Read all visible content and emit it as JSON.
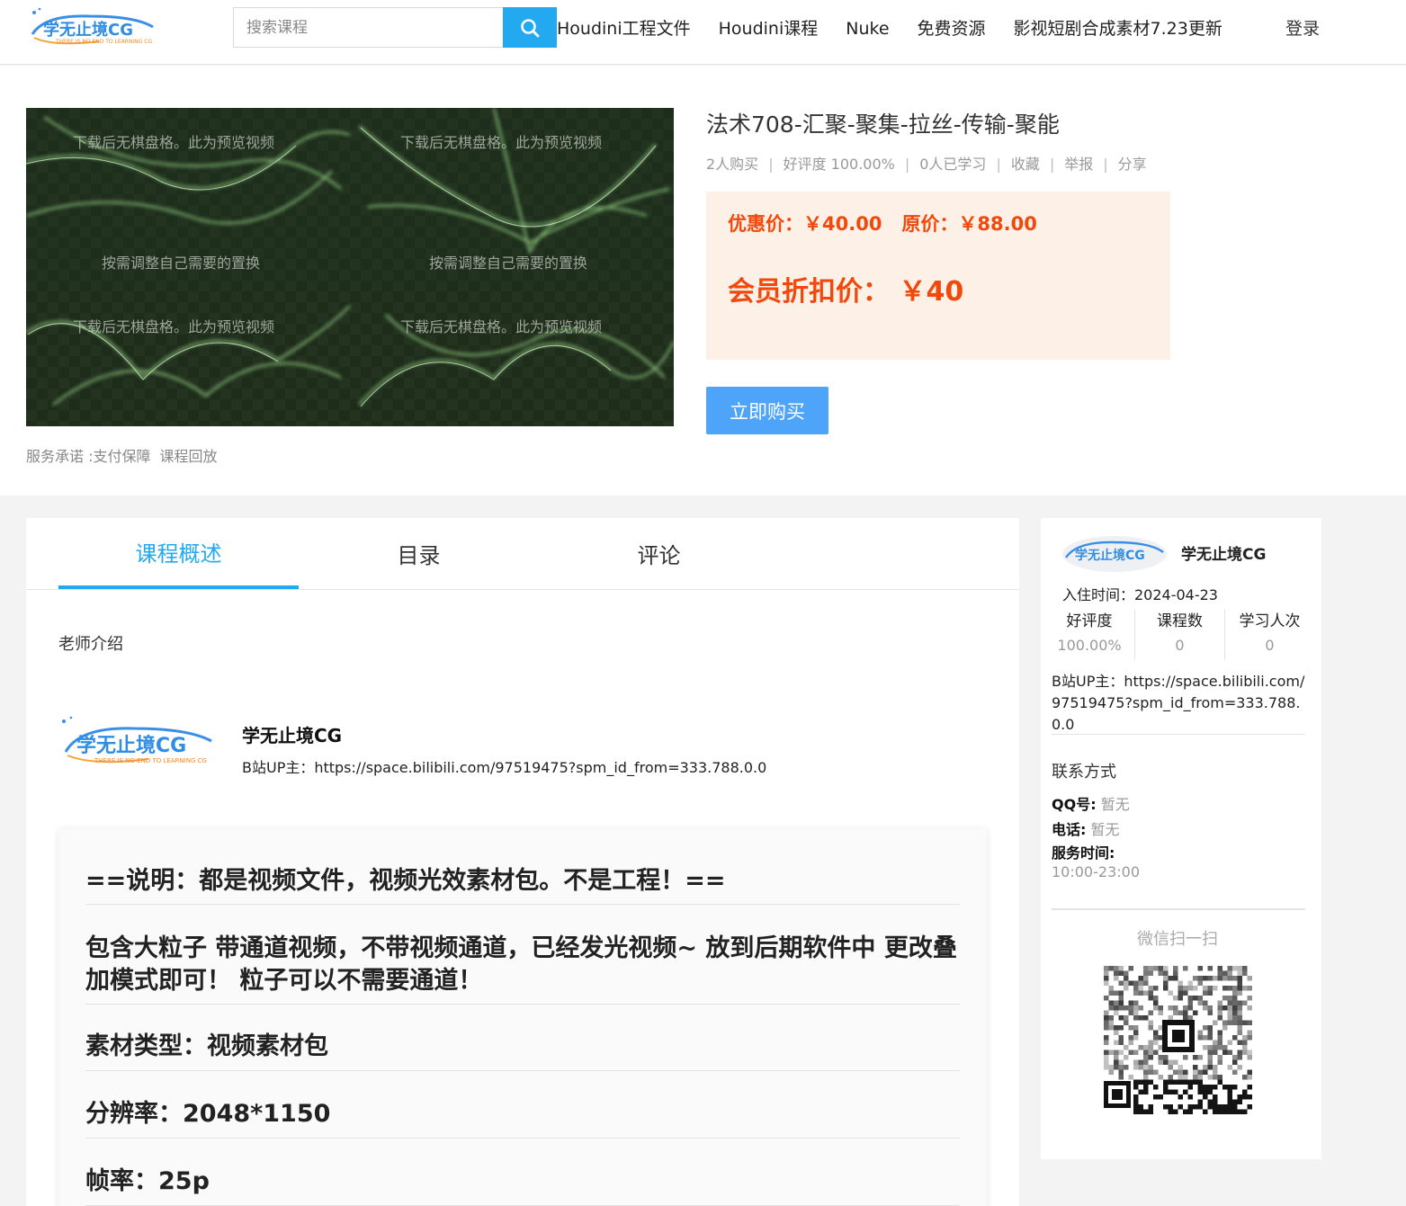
{
  "header": {
    "logo_text": "学无止境CG",
    "logo_sub": "THERE IS NO END TO LEARNING CG",
    "search_placeholder": "搜索课程",
    "nav": [
      "Houdini工程文件",
      "Houdini课程",
      "Nuke",
      "免费资源",
      "影视短剧合成素材7.23更新"
    ],
    "login": "登录"
  },
  "course": {
    "title": "法术708-汇聚-聚集-拉丝-传输-聚能",
    "buyers": "2人购买",
    "rating": "好评度 100.00%",
    "learners": "0人已学习",
    "favorite": "收藏",
    "report": "举报",
    "share": "分享",
    "sale_price": "优惠价：￥40.00",
    "original_price": "原价：￥88.00",
    "member_price": "会员折扣价： ￥40",
    "buy_button": "立即购买",
    "promise_label": "服务承诺 :支付保障",
    "promise_replay": "课程回放",
    "preview_watermark": "下载后无棋盘格。此为预览视频",
    "preview_caption": "按需调整自己需要的置换"
  },
  "tabs": [
    {
      "label": "课程概述",
      "active": true
    },
    {
      "label": "目录",
      "active": false
    },
    {
      "label": "评论",
      "active": false
    }
  ],
  "teacher": {
    "section_label": "老师介绍",
    "name": "学无止境CG",
    "desc": "B站UP主：https://space.bilibili.com/97519475?spm_id_from=333.788.0.0"
  },
  "description": {
    "lines": [
      "==说明：都是视频文件，视频光效素材包。不是工程！==",
      "包含大粒子 带通道视频，不带视频通道，已经发光视频~ 放到后期软件中 更改叠加模式即可！ 粒子可以不需要通道！",
      "素材类型：视频素材包",
      "分辨率：2048*1150",
      "帧率：25p"
    ]
  },
  "sidebar": {
    "name": "学无止境CG",
    "join_date": "入住时间：2024-04-23",
    "stats": [
      {
        "label": "好评度",
        "value": "100.00%"
      },
      {
        "label": "课程数",
        "value": "0"
      },
      {
        "label": "学习人次",
        "value": "0"
      }
    ],
    "desc": "B站UP主：https://space.bilibili.com/97519475?spm_id_from=333.788.0.0",
    "contact_title": "联系方式",
    "qq_label": "QQ号:",
    "qq_value": "暂无",
    "phone_label": "电话:",
    "phone_value": "暂无",
    "service_label": "服务时间:",
    "service_value": "10:00-23:00",
    "wechat_label": "微信扫一扫"
  },
  "colors": {
    "accent": "#22a9f0",
    "price": "#f1490b",
    "buy_button": "#4ea4f8",
    "price_bg": "#fdf1e7"
  }
}
